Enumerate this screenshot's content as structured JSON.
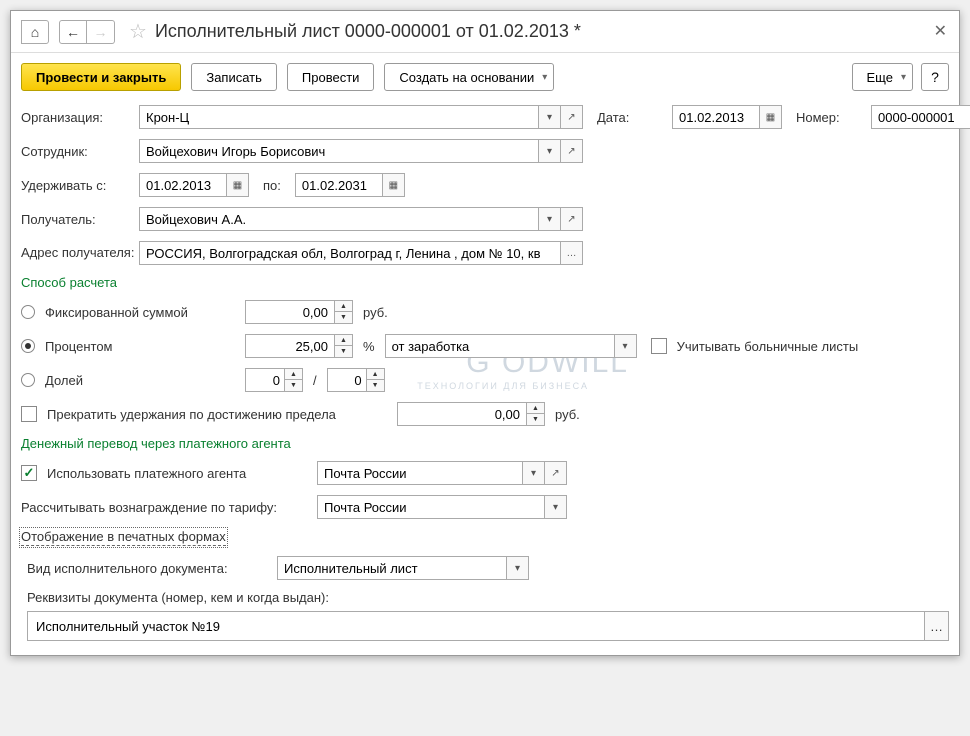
{
  "title": "Исполнительный лист 0000-000001 от 01.02.2013 *",
  "toolbar": {
    "submit_close": "Провести и закрыть",
    "save": "Записать",
    "submit": "Провести",
    "create_based": "Создать на основании",
    "more": "Еще",
    "help": "?"
  },
  "fields": {
    "org_lbl": "Организация:",
    "org_val": "Крон-Ц",
    "date_lbl": "Дата:",
    "date_val": "01.02.2013",
    "num_lbl": "Номер:",
    "num_val": "0000-000001",
    "employee_lbl": "Сотрудник:",
    "employee_val": "Войцехович Игорь Борисович",
    "withhold_from_lbl": "Удерживать с:",
    "withhold_from_val": "01.02.2013",
    "to_lbl": "по:",
    "to_val": "01.02.2031",
    "recipient_lbl": "Получатель:",
    "recipient_val": "Войцехович А.А.",
    "addr_lbl": "Адрес получателя:",
    "addr_val": "РОССИЯ, Волгоградская обл, Волгоград г, Ленина , дом № 10, кв"
  },
  "calc": {
    "section": "Способ расчета",
    "fixed": "Фиксированной суммой",
    "fixed_val": "0,00",
    "rub": "руб.",
    "percent": "Процентом",
    "percent_val": "25,00",
    "pct": "%",
    "base": "от заработка",
    "sick_leave": "Учитывать больничные листы",
    "fraction": "Долей",
    "frac_num": "0",
    "frac_den": "0",
    "slash": "/",
    "stop_limit": "Прекратить удержания по достижению предела",
    "limit_val": "0,00"
  },
  "transfer": {
    "section": "Денежный перевод через платежного агента",
    "use_agent": "Использовать платежного агента",
    "agent_val": "Почта России",
    "tariff_lbl": "Рассчитывать вознаграждение по тарифу:",
    "tariff_val": "Почта России"
  },
  "print": {
    "section": "Отображение в печатных формах",
    "doc_type_lbl": "Вид исполнительного документа:",
    "doc_type_val": "Исполнительный лист",
    "details_lbl": "Реквизиты документа (номер, кем и когда выдан):",
    "details_val": "Исполнительный участок №19"
  },
  "wm": {
    "main": "G   ODWILL",
    "sub": "ТЕХНОЛОГИИ ДЛЯ БИЗНЕСА"
  }
}
